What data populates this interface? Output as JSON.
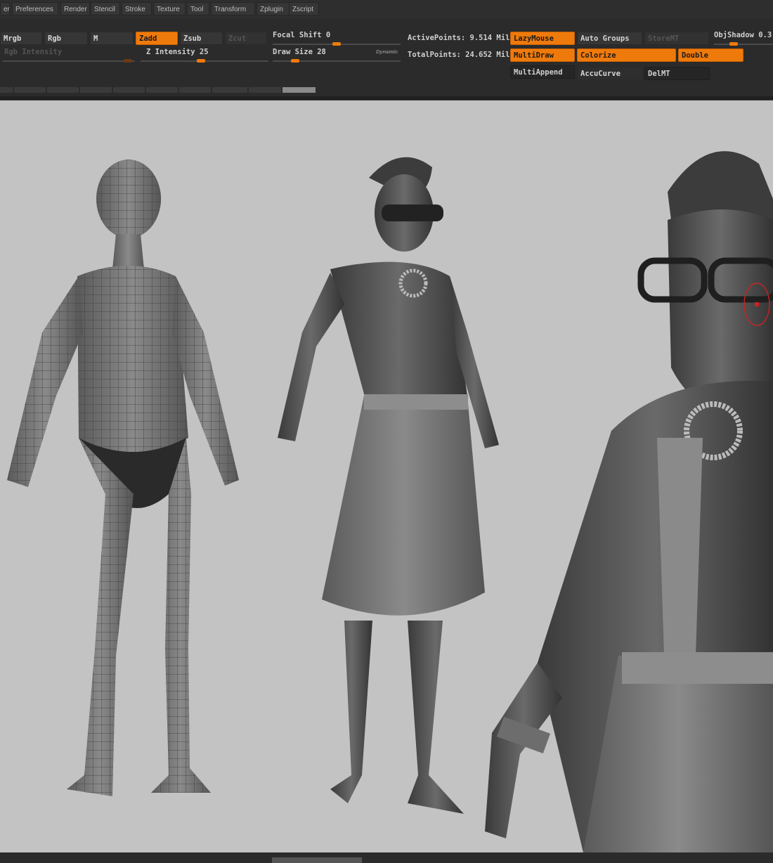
{
  "menu": [
    "er",
    "Preferences",
    "Render",
    "Stencil",
    "Stroke",
    "Texture",
    "Tool",
    "Transform",
    "Zplugin",
    "Zscript"
  ],
  "toolbar": {
    "mrgb": "Mrgb",
    "rgb": "Rgb",
    "m": "M",
    "zadd": "Zadd",
    "zsub": "Zsub",
    "zcut": "Zcut",
    "rgb_intensity": "Rgb Intensity",
    "z_intensity_label": "Z Intensity",
    "z_intensity_value": "25",
    "focal_shift_label": "Focal Shift",
    "focal_shift_value": "0",
    "draw_size_label": "Draw Size",
    "draw_size_value": "28",
    "dynamic": "Dynamic",
    "active_points": "ActivePoints: 9.514 Mil",
    "total_points": "TotalPoints: 24.652 Mil",
    "lazymouse": "LazyMouse",
    "auto_groups": "Auto Groups",
    "storemt": "StoreMT",
    "objshadow_label": "ObjShadow",
    "objshadow_value": "0.3",
    "multidraw": "MultiDraw",
    "colorize": "Colorize",
    "double": "Double",
    "multiappend": "MultiAppend",
    "accucurve": "AccuCurve",
    "delmt": "DelMT"
  },
  "colors": {
    "accent": "#ef7a0c",
    "viewport_bg": "#c3c3c3",
    "ui_bg": "#2b2b2b"
  },
  "sliders": {
    "z_intensity": 0.25,
    "focal_shift": 0.5,
    "draw_size": 0.15,
    "objshadow": 0.3
  }
}
